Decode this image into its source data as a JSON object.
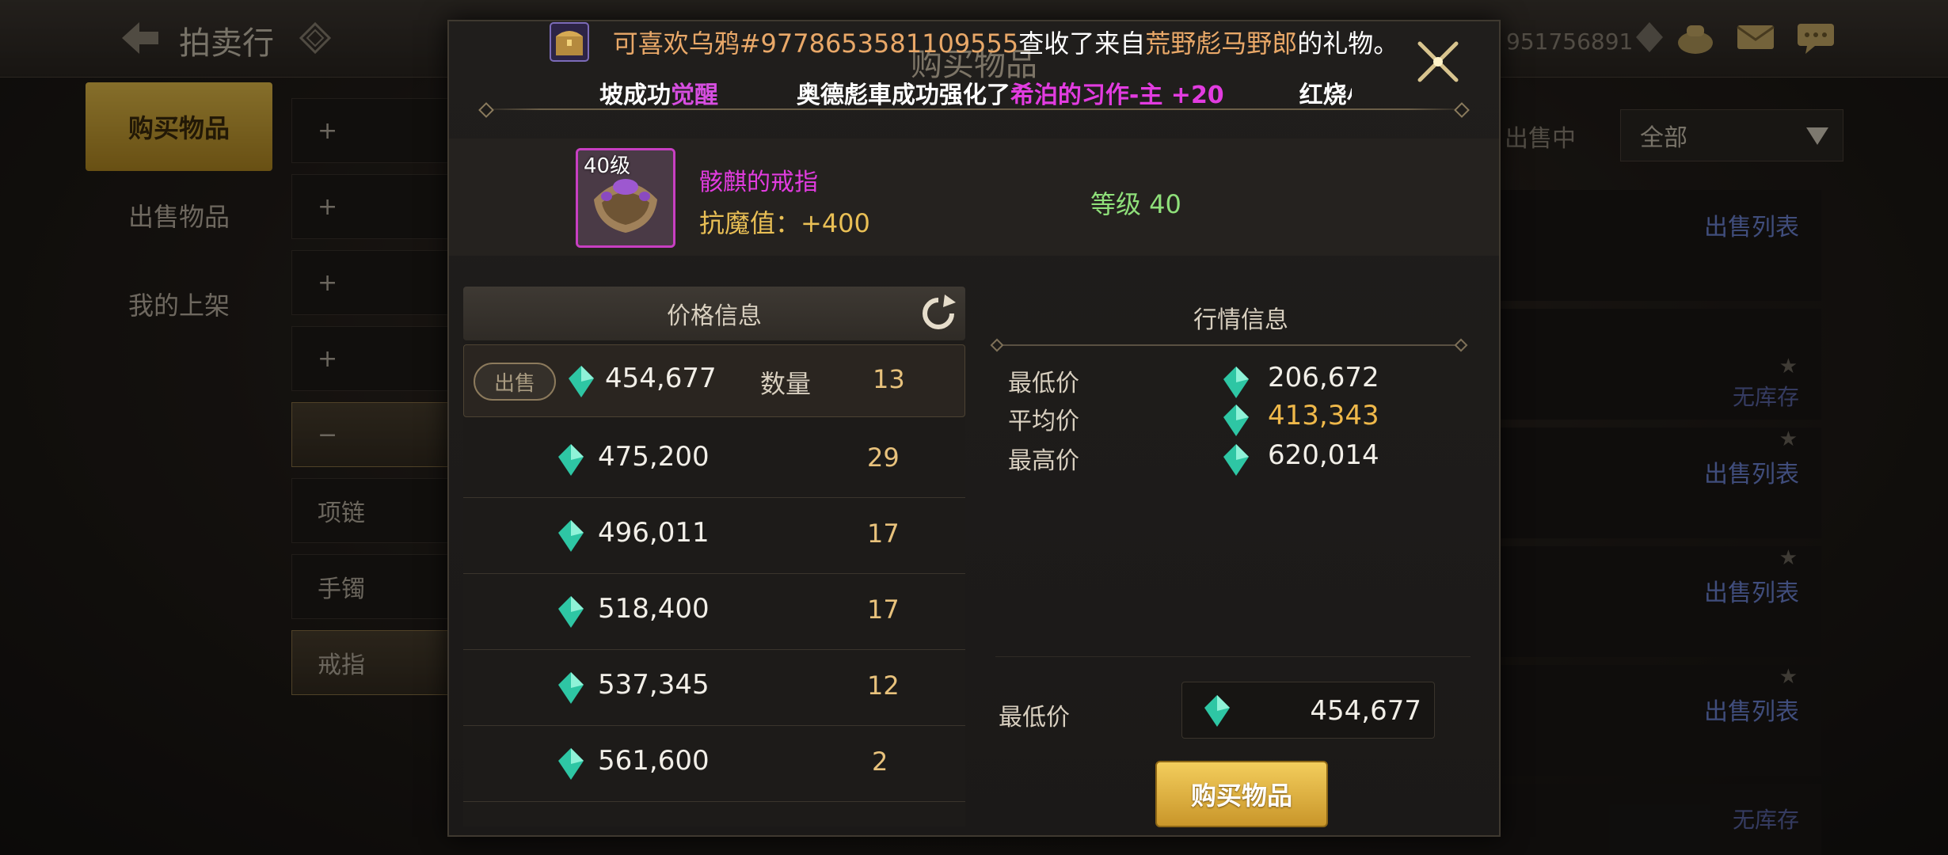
{
  "background": {
    "header_title": "拍卖行",
    "currency_value": "951756891",
    "left_menu": [
      {
        "label": "购买物品",
        "active": true
      },
      {
        "label": "出售物品",
        "active": false
      },
      {
        "label": "我的上架",
        "active": false
      }
    ],
    "categories": [
      {
        "label": "项链"
      },
      {
        "label": "手镯"
      },
      {
        "label": "戒指"
      }
    ],
    "filter_label": "出售中",
    "filter_value": "全部",
    "right_rows": [
      {
        "link": "出售列表",
        "stock": ""
      },
      {
        "link": "",
        "stock": "无库存"
      },
      {
        "link": "出售列表",
        "stock": ""
      },
      {
        "link": "出售列表",
        "stock": ""
      },
      {
        "link": "出售列表",
        "stock": ""
      },
      {
        "link": "",
        "stock": "无库存"
      }
    ]
  },
  "notification": {
    "user": "可喜欢乌鸦#9778653581109555",
    "action": "查收了来自",
    "sender": "荒野彪马野郎",
    "suffix": "的礼物。",
    "colors": {
      "user": "#e9a868",
      "sender": "#e9a868",
      "text": "#ffffff"
    }
  },
  "modal": {
    "title": "购买物品",
    "ticker": {
      "part1": "坡成功",
      "part1_highlight": "觉醒",
      "part2": "奥德彪車成功强化了",
      "part2_highlight": "希泊的习作-主 +20",
      "part3": "红烧小"
    },
    "item": {
      "level_tag": "40级",
      "name": "骸麒的戒指",
      "stat": "抗魔值：+400",
      "level": "等级 40",
      "name_color": "#e23ce0"
    },
    "price_panel": {
      "header": "价格信息",
      "sell_label": "出售",
      "qty_label": "数量",
      "rows": [
        {
          "price": "454,677",
          "qty": "13"
        },
        {
          "price": "475,200",
          "qty": "29"
        },
        {
          "price": "496,011",
          "qty": "17"
        },
        {
          "price": "518,400",
          "qty": "17"
        },
        {
          "price": "537,345",
          "qty": "12"
        },
        {
          "price": "561,600",
          "qty": "2"
        }
      ]
    },
    "market_panel": {
      "header": "行情信息",
      "min_label": "最低价",
      "min_value": "206,672",
      "avg_label": "平均价",
      "avg_value": "413,343",
      "max_label": "最高价",
      "max_value": "620,014"
    },
    "purchase": {
      "min_label": "最低价",
      "min_value": "454,677",
      "button": "购买物品"
    }
  }
}
